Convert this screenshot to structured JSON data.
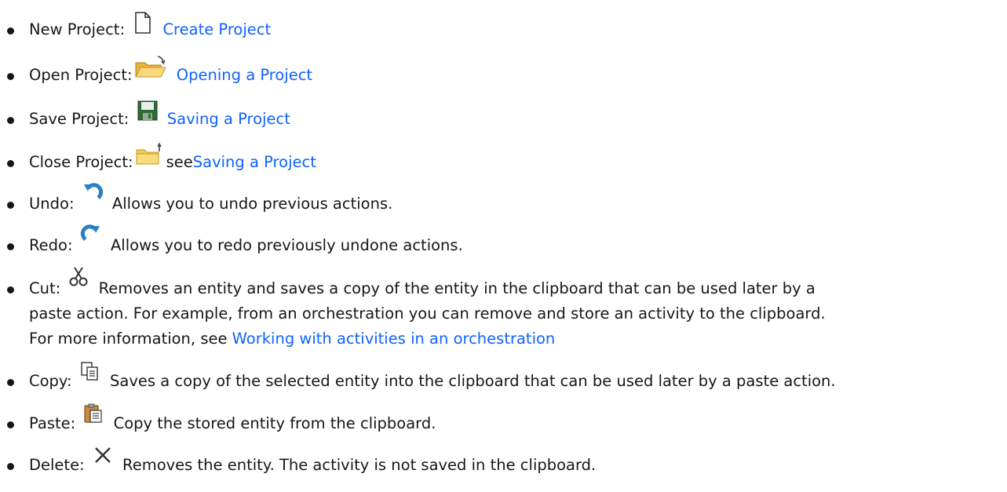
{
  "items": [
    {
      "term": "New Project:",
      "icon": "new-file-icon",
      "link": "Create Project"
    },
    {
      "term": "Open Project:",
      "icon": "open-folder-icon",
      "link": "Opening a Project"
    },
    {
      "term": "Save Project:",
      "icon": "floppy-disk-icon",
      "link": "Saving a Project"
    },
    {
      "term": "Close Project:",
      "icon": "close-folder-icon",
      "prefix": "see",
      "link": "Saving a Project"
    },
    {
      "term": "Undo:",
      "icon": "undo-icon",
      "description": "Allows you to undo previous actions."
    },
    {
      "term": "Redo:",
      "icon": "redo-icon",
      "description": "Allows you to redo previously undone actions."
    },
    {
      "term": "Cut:",
      "icon": "scissors-icon",
      "line1": "Removes an entity and saves a copy of the entity in the clipboard that can be used later by a",
      "line2": "paste action. For example, from an orchestration you can remove and store an activity to the clipboard.",
      "line3": "For more information, see ",
      "link": "Working with activities in an orchestration"
    },
    {
      "term": "Copy:",
      "icon": "copy-icon",
      "description": "Saves a copy of the selected entity into the clipboard that can be used later by a paste action."
    },
    {
      "term": "Paste:",
      "icon": "paste-icon",
      "description": "Copy the stored entity from the clipboard."
    },
    {
      "term": "Delete:",
      "icon": "delete-x-icon",
      "description": "Removes the entity. The activity is not saved in the clipboard."
    }
  ],
  "colors": {
    "link": "#0f62fe",
    "text": "#161616"
  }
}
